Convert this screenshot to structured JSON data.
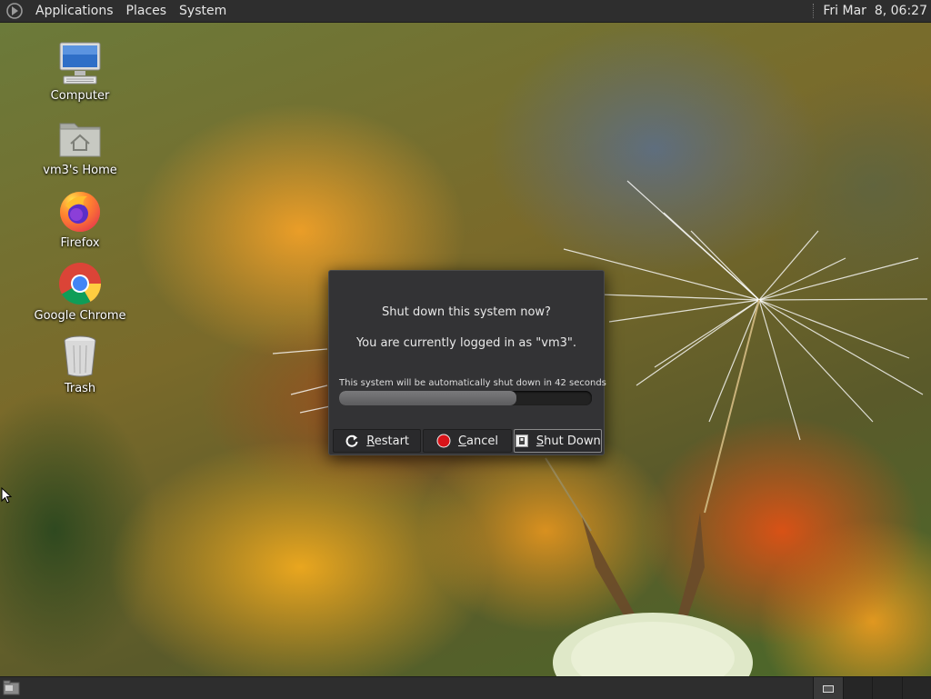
{
  "top_panel": {
    "menus": [
      "Applications",
      "Places",
      "System"
    ],
    "clock": "Fri Mar  8, 06:27",
    "logo_icon": "mate-logo-icon"
  },
  "desktop_icons": [
    {
      "label": "Computer",
      "icon": "computer-icon"
    },
    {
      "label": "vm3's Home",
      "icon": "home-folder-icon"
    },
    {
      "label": "Firefox",
      "icon": "firefox-icon"
    },
    {
      "label": "Google Chrome",
      "icon": "chrome-icon"
    },
    {
      "label": "Trash",
      "icon": "trash-icon"
    }
  ],
  "dialog": {
    "title": "Shut down this system now?",
    "subtitle": "You are currently logged in as \"vm3\".",
    "countdown": "This system will be automatically shut down in 42 seconds",
    "progress_fraction": 0.7,
    "buttons": {
      "restart": "Restart",
      "cancel": "Cancel",
      "shutdown": "Shut Down"
    },
    "default_button": "shutdown"
  },
  "bottom_panel": {
    "show_desktop_icon": "show-desktop-icon",
    "workspaces": 4,
    "active_workspace": 1
  },
  "colors": {
    "panel_bg": "#2e2e2e",
    "dialog_bg": "#333335",
    "cancel_red": "#d8141a"
  }
}
